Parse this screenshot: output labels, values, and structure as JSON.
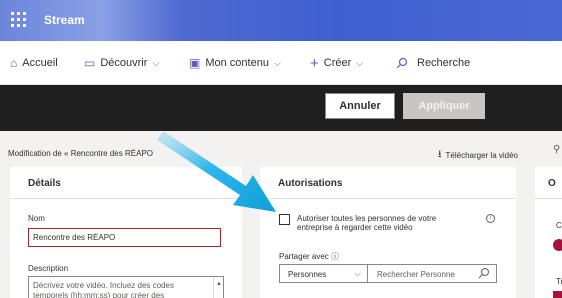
{
  "topbar": {
    "app_name": "Stream"
  },
  "nav": {
    "home": "Accueil",
    "discover": "Découvrir",
    "my_content": "Mon contenu",
    "create": "Créer",
    "search": "Recherche"
  },
  "actions": {
    "cancel": "Annuler",
    "apply": "Appliquer"
  },
  "page": {
    "breadcrumb": "Modification de « Rencontre des RÉAPO",
    "download": "Télécharger la vidéo"
  },
  "details": {
    "title": "Détails",
    "name_label": "Nom",
    "name_value": "Rencontre des RÉAPO",
    "description_label": "Description",
    "description_placeholder": "Décrivez votre vidéo. Incluez des codes temporels (hh:mm:ss) pour créer des"
  },
  "permissions": {
    "title": "Autorisations",
    "allow_label": "Autoriser toutes les personnes de votre entreprise à regarder cette vidéo",
    "share_label": "Partager avec ⓘ",
    "share_type": "Personnes",
    "search_placeholder": "Rechercher Personne"
  },
  "options": {
    "title_fragment": "O",
    "label1": "Co",
    "label2": "Tr"
  },
  "colors": {
    "accent": "#5b5fc7",
    "error": "#a4262c",
    "toggle": "#a4133c",
    "arrow": "#1aa8e0"
  },
  "icons": [
    "waffle-icon",
    "home-icon",
    "discover-icon",
    "my-content-icon",
    "plus-icon",
    "search-icon",
    "download-icon",
    "info-icon",
    "chevron-down-icon"
  ]
}
